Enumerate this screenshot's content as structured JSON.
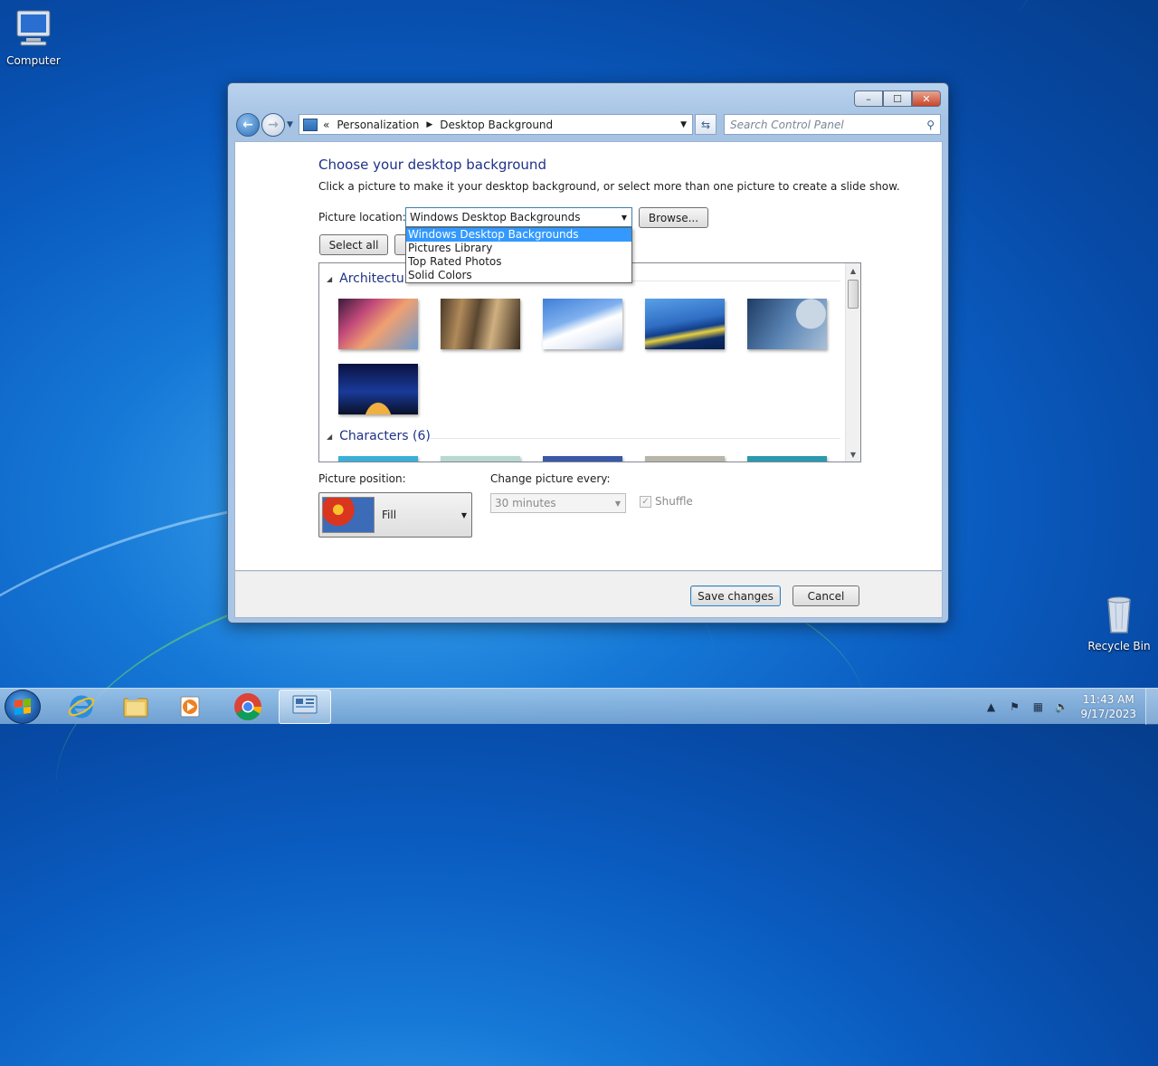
{
  "desktop": {
    "icons": [
      {
        "label": "Computer"
      },
      {
        "label": "Recycle Bin"
      }
    ]
  },
  "window": {
    "controls": {
      "minimize": "–",
      "maximize": "☐",
      "close": "✕"
    },
    "nav": {
      "back_icon": "arrow-left-icon",
      "breadcrumb_prefix": "«",
      "breadcrumbs": [
        "Personalization",
        "Desktop Background"
      ],
      "search_placeholder": "Search Control Panel"
    },
    "title": "Choose your desktop background",
    "description": "Click a picture to make it your desktop background, or select more than one picture to create a slide show.",
    "location": {
      "label": "Picture location:",
      "value": "Windows Desktop Backgrounds",
      "options": [
        "Windows Desktop Backgrounds",
        "Pictures Library",
        "Top Rated Photos",
        "Solid Colors"
      ],
      "selected_index": 0
    },
    "browse_label": "Browse...",
    "select_all_label": "Select all",
    "groups": [
      {
        "name": "Architecture (6)",
        "visible_name": "Architecture"
      },
      {
        "name": "Characters (6)"
      }
    ],
    "position": {
      "label": "Picture position:",
      "value": "Fill"
    },
    "change": {
      "label": "Change picture every:",
      "value": "30 minutes"
    },
    "shuffle": {
      "label": "Shuffle",
      "checked": true,
      "disabled": true
    },
    "save_label": "Save changes",
    "cancel_label": "Cancel"
  },
  "taskbar": {
    "apps": [
      "internet-explorer",
      "windows-explorer",
      "media-player",
      "chrome",
      "control-panel"
    ],
    "active_app": "control-panel",
    "clock": {
      "time": "11:43 AM",
      "date": "9/17/2023"
    }
  },
  "colors": {
    "accent": "#1e3287",
    "selection": "#3399ff"
  }
}
